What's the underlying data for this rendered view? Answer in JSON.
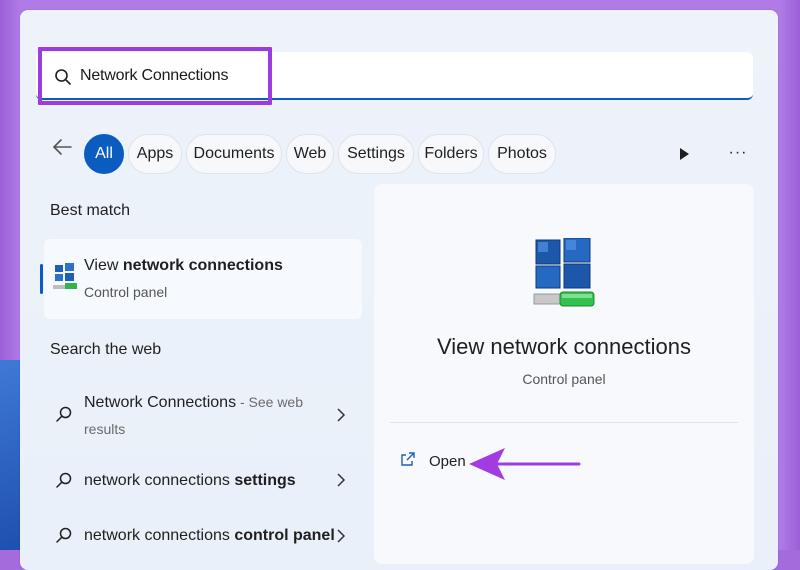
{
  "search": {
    "query": "Network Connections"
  },
  "filters": [
    {
      "label": "All",
      "active": true
    },
    {
      "label": "Apps",
      "active": false
    },
    {
      "label": "Documents",
      "active": false
    },
    {
      "label": "Web",
      "active": false
    },
    {
      "label": "Settings",
      "active": false
    },
    {
      "label": "Folders",
      "active": false
    },
    {
      "label": "Photos",
      "active": false
    }
  ],
  "more_dots": "···",
  "best_match": {
    "heading": "Best match",
    "title_prefix": "View ",
    "title_bold": "network connections",
    "subtitle": "Control panel"
  },
  "web": {
    "heading": "Search the web",
    "results": [
      {
        "plain": "Network Connections",
        "suffix": " - See web",
        "suffix2": "results"
      },
      {
        "plain": "network connections ",
        "bold": "settings"
      },
      {
        "plain": "network connections ",
        "bold": "control panel"
      }
    ]
  },
  "preview": {
    "title": "View network connections",
    "subtitle": "Control panel",
    "open_label": "Open"
  },
  "colors": {
    "accent": "#0a5cbf",
    "highlight": "#9a3ce0",
    "arrow": "#a23be2"
  }
}
